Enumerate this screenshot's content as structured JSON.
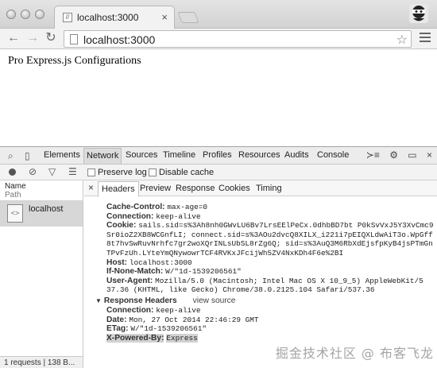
{
  "browser": {
    "tab_title": "localhost:3000",
    "url": "localhost:3000"
  },
  "page": {
    "heading": "Pro Express.js Configurations"
  },
  "devtools": {
    "panels": [
      "Elements",
      "Network",
      "Sources",
      "Timeline",
      "Profiles",
      "Resources",
      "Audits",
      "Console"
    ],
    "active_panel": "Network",
    "network_toolbar": {
      "preserve_log": "Preserve log",
      "disable_cache": "Disable cache"
    },
    "request_list": {
      "col_name": "Name",
      "col_path": "Path",
      "items": [
        {
          "name": "localhost"
        }
      ],
      "status": "1 requests | 138 B..."
    },
    "detail_tabs": [
      "Headers",
      "Preview",
      "Response",
      "Cookies",
      "Timing"
    ],
    "active_detail_tab": "Headers",
    "request_headers": [
      {
        "key": "Cache-Control:",
        "value": "max-age=0"
      },
      {
        "key": "Connection:",
        "value": "keep-alive"
      },
      {
        "key": "Cookie:",
        "value": "sails.sid=s%3Ah8nh0GWvLU6Bv7LrsEElPeCx.0dhbBD7bt P0kSvVxJ5Y3XvCmc9",
        "cont": [
          "Sr0ioZ2XB8WCGnfLI; connect.sid=s%3AOu2dvcQ8XILX_i221i7pEIQXLdwAiT3o.WpGff",
          "8t7hvSwRuvNrhfc7gr2woXQrINLsUbSL8rZg6Q; sid=s%3AuQ3M6RbXdEjsfpKyB4jsPTmGn",
          "TPvFzUh.LYteYmQNywowrTCF4RVKxJFcijWh5ZV4NxKDh4F6e%2BI"
        ]
      },
      {
        "key": "Host:",
        "value": "localhost:3000"
      },
      {
        "key": "If-None-Match:",
        "value": "W/\"1d-1539206561\""
      },
      {
        "key": "User-Agent:",
        "value": "Mozilla/5.0 (Macintosh; Intel Mac OS X 10_9_5) AppleWebKit/5",
        "cont": [
          "37.36 (KHTML, like Gecko) Chrome/38.0.2125.104 Safari/537.36"
        ]
      }
    ],
    "response_section": {
      "title": "Response Headers",
      "view_source": "view source"
    },
    "response_headers": [
      {
        "key": "Connection:",
        "value": "keep-alive"
      },
      {
        "key": "Date:",
        "value": "Mon, 27 Oct 2014 22:46:29 GMT"
      },
      {
        "key": "ETag:",
        "value": "W/\"1d-1539206561\""
      },
      {
        "key": "X-Powered-By:",
        "value": "Express",
        "highlight": true
      }
    ]
  },
  "watermark": "掘金技术社区 @ 布客飞龙"
}
